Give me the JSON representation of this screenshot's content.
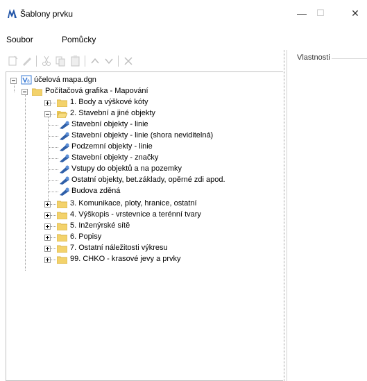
{
  "window": {
    "title": "Šablony prvku",
    "minimize": "—",
    "maximize": "☐",
    "close": "✕"
  },
  "menu": {
    "items": [
      "Soubor",
      "Pomůcky"
    ]
  },
  "properties_panel": {
    "title": "Vlastnosti"
  },
  "tree": {
    "root": "účelová mapa.dgn",
    "group": "Počítačová grafika - Mapování",
    "folders": [
      "1. Body a výškové kóty",
      "2. Stavební a jiné objekty",
      "3. Komunikace, ploty, hranice, ostatní",
      "4. Výškopis - vrstevnice a terénní tvary",
      "5. Inženýrské sítě",
      "6. Popisy",
      "7. Ostatní náležitosti výkresu",
      "99. CHKO - krasové jevy a prvky"
    ],
    "expanded_children": [
      "Stavební objekty - linie",
      "Stavební objekty - linie (shora neviditelná)",
      "Podzemní objekty - linie",
      "Stavební objekty - značky",
      "Vstupy do objektů a na pozemky",
      "Ostatní objekty, bet.základy, opěrné zdi apod.",
      "Budova zděná"
    ]
  },
  "colors": {
    "folder": "#f3d26b",
    "template_icon": "#2f5fa8",
    "root_icon": "#3a7bd5"
  }
}
